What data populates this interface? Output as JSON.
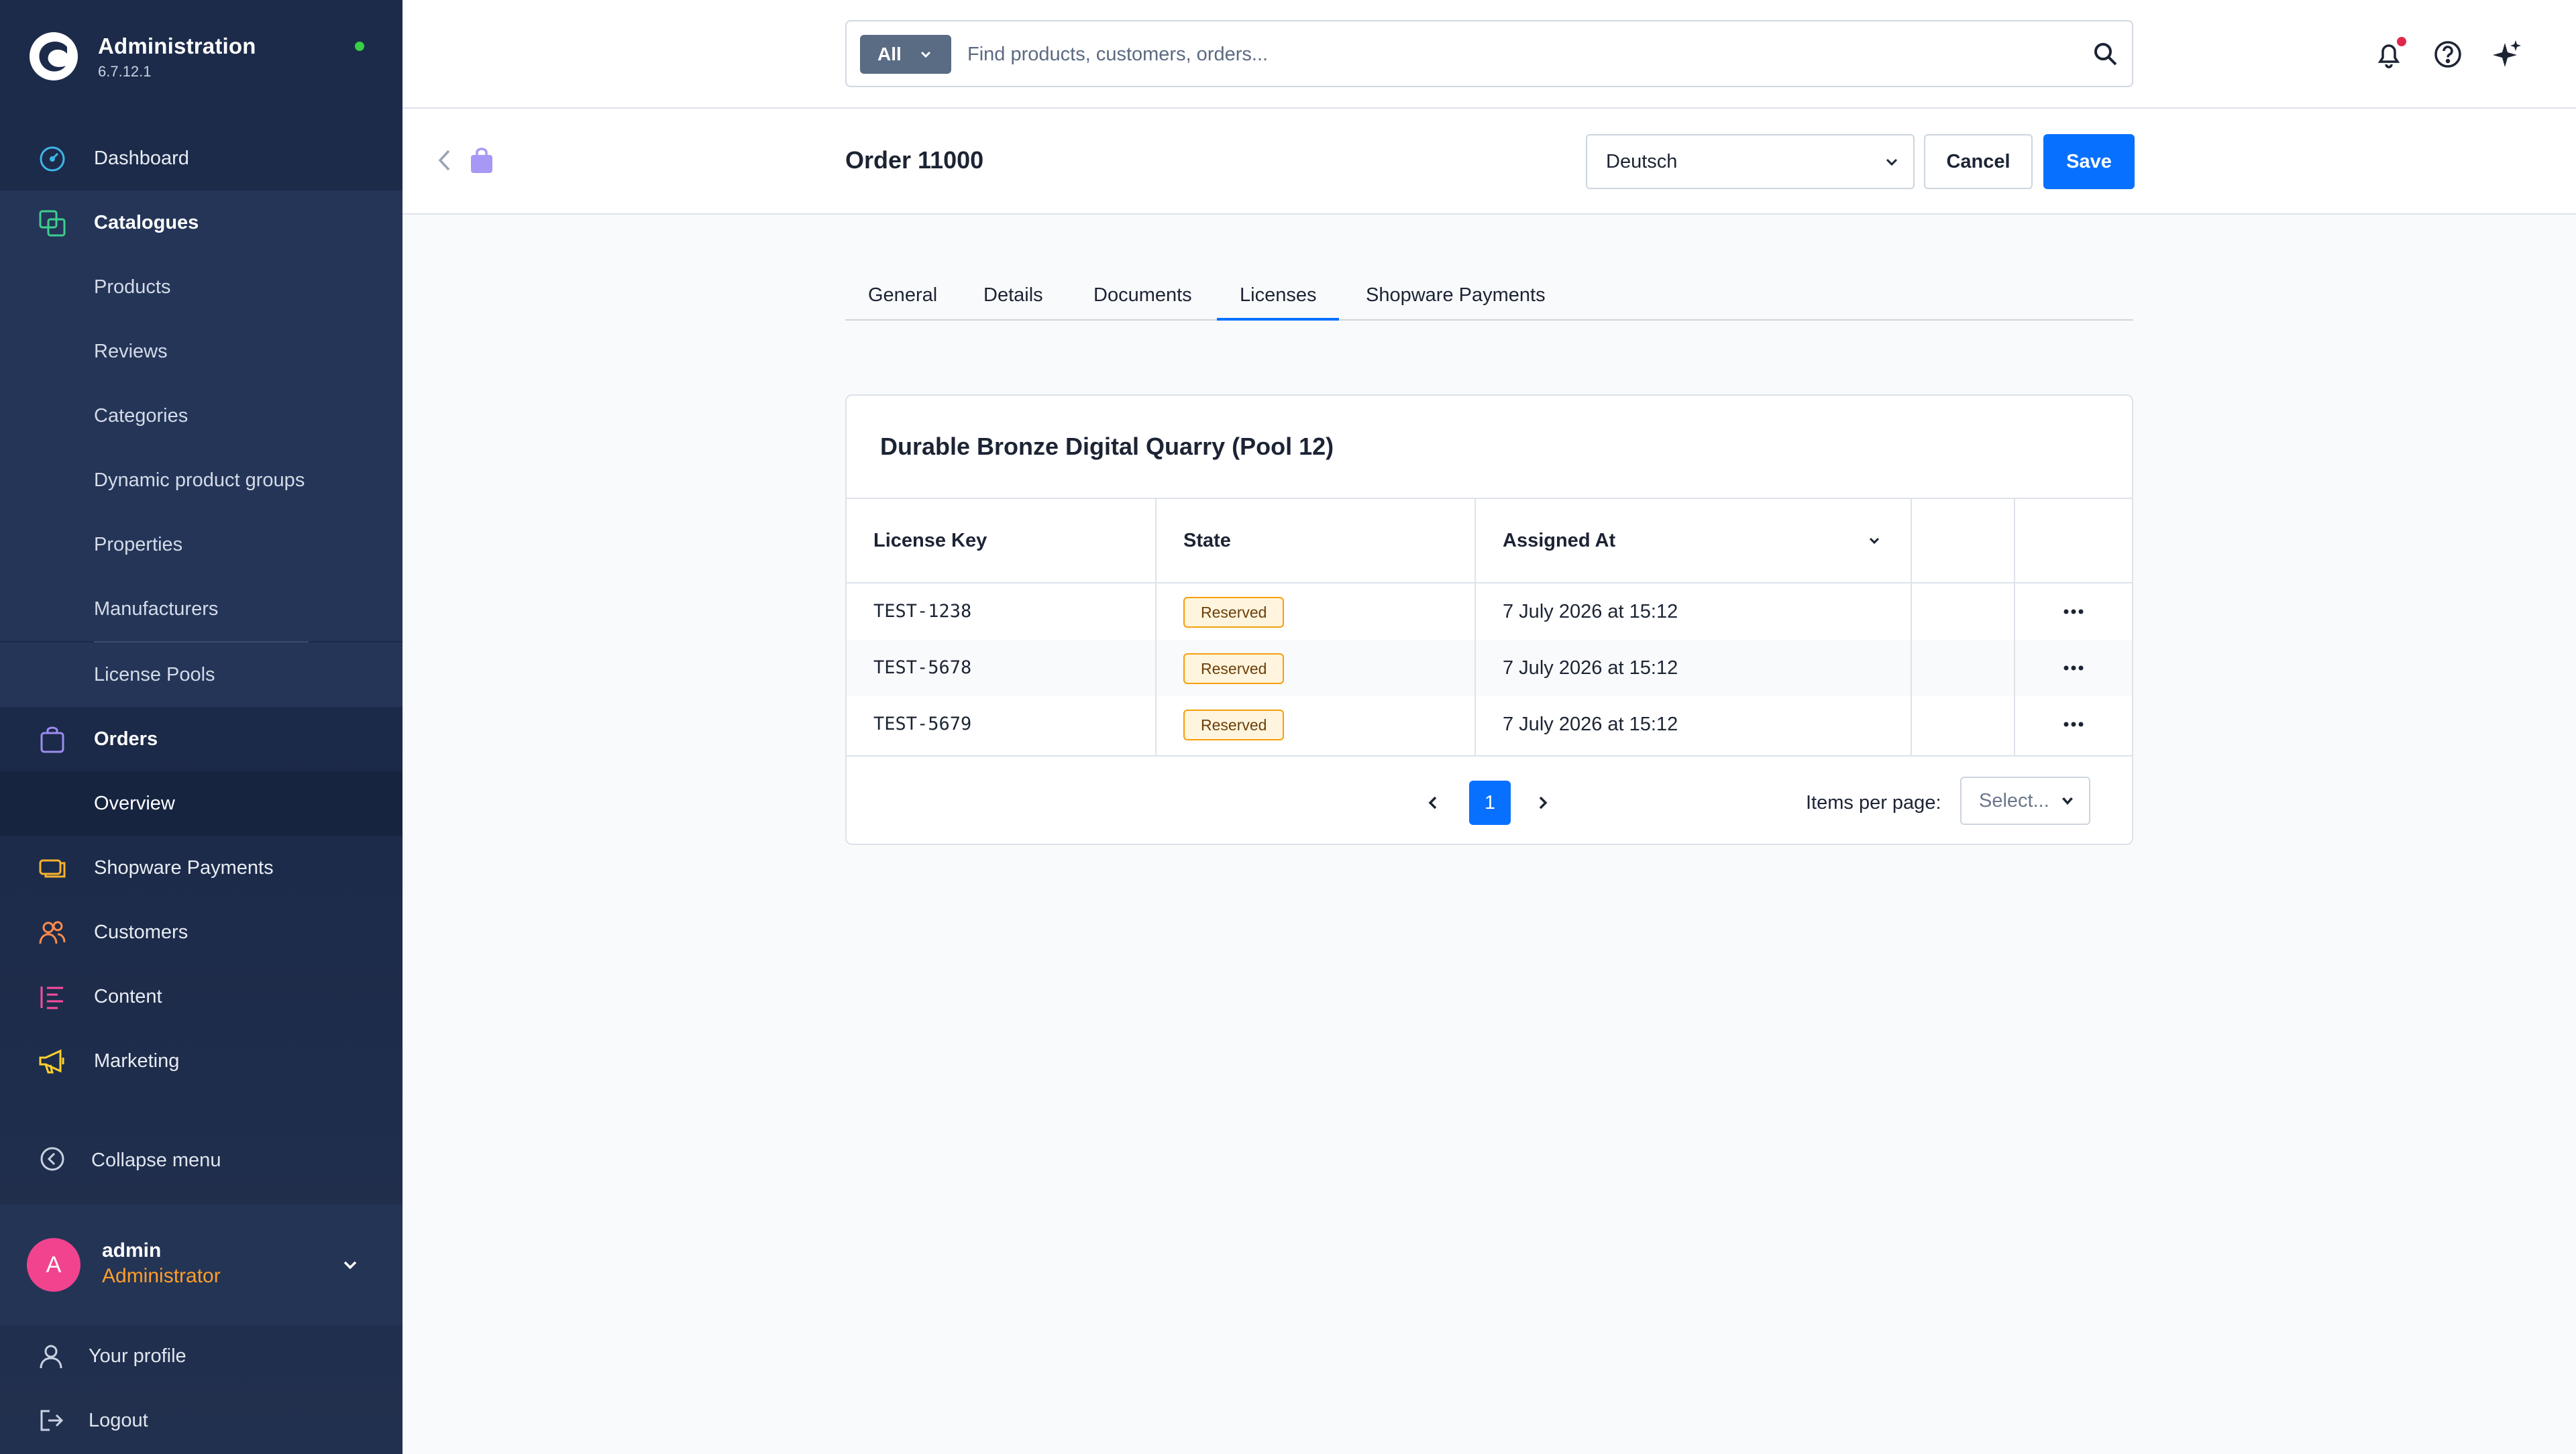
{
  "sidebar": {
    "title": "Administration",
    "version": "6.7.12.1",
    "items": [
      {
        "label": "Dashboard"
      },
      {
        "label": "Catalogues"
      },
      {
        "label": "Products"
      },
      {
        "label": "Reviews"
      },
      {
        "label": "Categories"
      },
      {
        "label": "Dynamic product groups"
      },
      {
        "label": "Properties"
      },
      {
        "label": "Manufacturers"
      },
      {
        "label": "License Pools"
      },
      {
        "label": "Orders"
      },
      {
        "label": "Overview"
      },
      {
        "label": "Shopware Payments"
      },
      {
        "label": "Customers"
      },
      {
        "label": "Content"
      },
      {
        "label": "Marketing"
      }
    ],
    "collapse_label": "Collapse menu",
    "user": {
      "initial": "A",
      "name": "admin",
      "role": "Administrator"
    },
    "footer": {
      "profile": "Your profile",
      "logout": "Logout"
    }
  },
  "topbar": {
    "search_scope": "All",
    "search_placeholder": "Find products, customers, orders..."
  },
  "smartbar": {
    "title": "Order 11000",
    "language": "Deutsch",
    "cancel": "Cancel",
    "save": "Save"
  },
  "tabs": [
    {
      "label": "General"
    },
    {
      "label": "Details"
    },
    {
      "label": "Documents"
    },
    {
      "label": "Licenses"
    },
    {
      "label": "Shopware Payments"
    }
  ],
  "card": {
    "title": "Durable Bronze Digital Quarry (Pool 12)",
    "columns": [
      "License Key",
      "State",
      "Assigned At"
    ],
    "rows": [
      {
        "key": "TEST-1238",
        "state": "Reserved",
        "assigned": "7 July 2026 at 15:12"
      },
      {
        "key": "TEST-5678",
        "state": "Reserved",
        "assigned": "7 July 2026 at 15:12"
      },
      {
        "key": "TEST-5679",
        "state": "Reserved",
        "assigned": "7 July 2026 at 15:12"
      }
    ],
    "pagination": {
      "current_page": "1",
      "items_per_page_label": "Items per page:",
      "items_per_page_value": "Select..."
    }
  },
  "colors": {
    "sidebar_bg": "#1c2b4a",
    "primary": "#0870ff",
    "badge_border": "#f59e0b",
    "badge_bg": "#fff5df",
    "avatar": "#f2448e",
    "role": "#ff9e2c",
    "online": "#37d046",
    "notification_dot": "#de294c"
  },
  "icons": {
    "logo": "shopware-logo-icon",
    "dashboard": "gauge-icon",
    "catalogues": "stacked-squares-icon",
    "orders": "shopping-bag-icon",
    "payments": "payment-card-icon",
    "customers": "users-icon",
    "content": "content-list-icon",
    "marketing": "megaphone-icon",
    "collapse": "circle-chevron-left-icon",
    "profile": "user-icon",
    "logout": "logout-icon",
    "search": "search-icon",
    "bell": "bell-icon",
    "help": "question-circle-icon",
    "ai": "sparkle-icon"
  }
}
